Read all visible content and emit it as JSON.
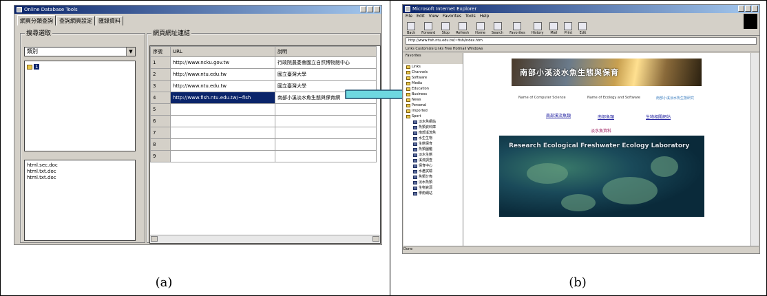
{
  "captions": {
    "a": "(a)",
    "b": "(b)"
  },
  "panel_a": {
    "window_title": "Online Database Tools",
    "tabs": [
      "網頁分類查詢",
      "查詢網頁設定",
      "匯錄資料"
    ],
    "left_group_label": "搜尋選取",
    "right_group_label": "網頁網址連結",
    "combo_value": "類別",
    "tree_node": "1",
    "list_items": [
      "html.sec.doc",
      "html.txt.doc",
      "html.txt.doc"
    ],
    "grid": {
      "headers": [
        "序號",
        "URL",
        "說明"
      ],
      "rows": [
        {
          "n": "1",
          "url": "http://www.ncku.gov.tw",
          "desc": "行政院農委會國立自然博物館中心"
        },
        {
          "n": "2",
          "url": "http://www.ntu.edu.tw",
          "desc": "國立臺灣大學"
        },
        {
          "n": "3",
          "url": "http://www.ntu.edu.tw",
          "desc": "國立臺灣大學"
        },
        {
          "n": "4",
          "url": "http://www.fish.ntu.edu.tw/~fish",
          "desc": "南部小溪淡水魚生態與保育網"
        },
        {
          "n": "5",
          "url": "",
          "desc": ""
        },
        {
          "n": "6",
          "url": "",
          "desc": ""
        },
        {
          "n": "7",
          "url": "",
          "desc": ""
        },
        {
          "n": "8",
          "url": "",
          "desc": ""
        },
        {
          "n": "9",
          "url": "",
          "desc": ""
        }
      ],
      "selected_row": 4
    }
  },
  "panel_b": {
    "window_title": "Microsoft Internet Explorer",
    "menu": [
      "File",
      "Edit",
      "View",
      "Favorites",
      "Tools",
      "Help"
    ],
    "toolbar": [
      "Back",
      "Forward",
      "Stop",
      "Refresh",
      "Home",
      "Search",
      "Favorites",
      "History",
      "Mail",
      "Print",
      "Edit"
    ],
    "address": "http://www.fish.ntu.edu.tw/~fish/index.htm",
    "links_bar": "Links  Customize Links  Free Hotmail  Windows",
    "sidebar_header": "Favorites",
    "sidebar_folders": [
      "Links",
      "Channels",
      "Software",
      "Media",
      "Education",
      "Business",
      "News",
      "Personal",
      "Imported",
      "Sport"
    ],
    "sidebar_subitems": [
      "淡水魚網站",
      "魚類資料庫",
      "南部溪流魚",
      "水生生物",
      "生態保育",
      "魚類圖鑑",
      "淡水生態",
      "溪流調查",
      "保育中心",
      "水產試驗",
      "魚類分佈",
      "淡水魚類",
      "生物資源",
      "學術網站"
    ],
    "banner_text": "南部小溪淡水魚生態與保育",
    "nav_items": [
      "Name of Computer Science",
      "Name of Ecology and Software",
      "南部小溪淡水魚生態研究"
    ],
    "link_items": [
      "南部溪流魚類",
      "南部魚類",
      "生物相關網站"
    ],
    "center_link": "淡水魚資料",
    "image_caption": "Research Ecological Freshwater Ecology Laboratory",
    "status": "Done"
  }
}
